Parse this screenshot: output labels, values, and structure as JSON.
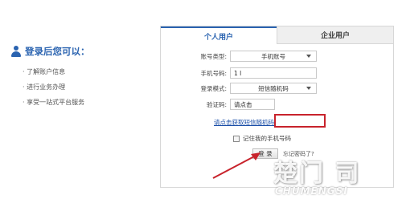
{
  "left_panel": {
    "title": "登录后您可以：",
    "items": [
      "· 了解账户信息",
      "· 进行业务办理",
      "· 享受一站式平台服务"
    ]
  },
  "tabs": [
    {
      "label": "个人用户",
      "active": true
    },
    {
      "label": "企业用户",
      "active": false
    }
  ],
  "form": {
    "account_type": {
      "label": "账号类型:",
      "value": "手机账号"
    },
    "phone": {
      "label": "手机号码:",
      "value": "1                  l"
    },
    "login_mode": {
      "label": "登录模式:",
      "value": "短信随机码"
    },
    "captcha": {
      "label": "验证码:",
      "value": "请点击"
    },
    "sms_link": "请点击获取短信随机码",
    "remember_label": "记住我的手机号码",
    "login_button": "登 录",
    "forgot_link": "忘记密码了?"
  },
  "colors": {
    "brand_blue": "#2a63b0",
    "highlight_red": "#c8232c"
  },
  "watermark": {
    "cn": "楚门",
    "cn_suffix": "司",
    "en": "CHUMENGSI"
  }
}
